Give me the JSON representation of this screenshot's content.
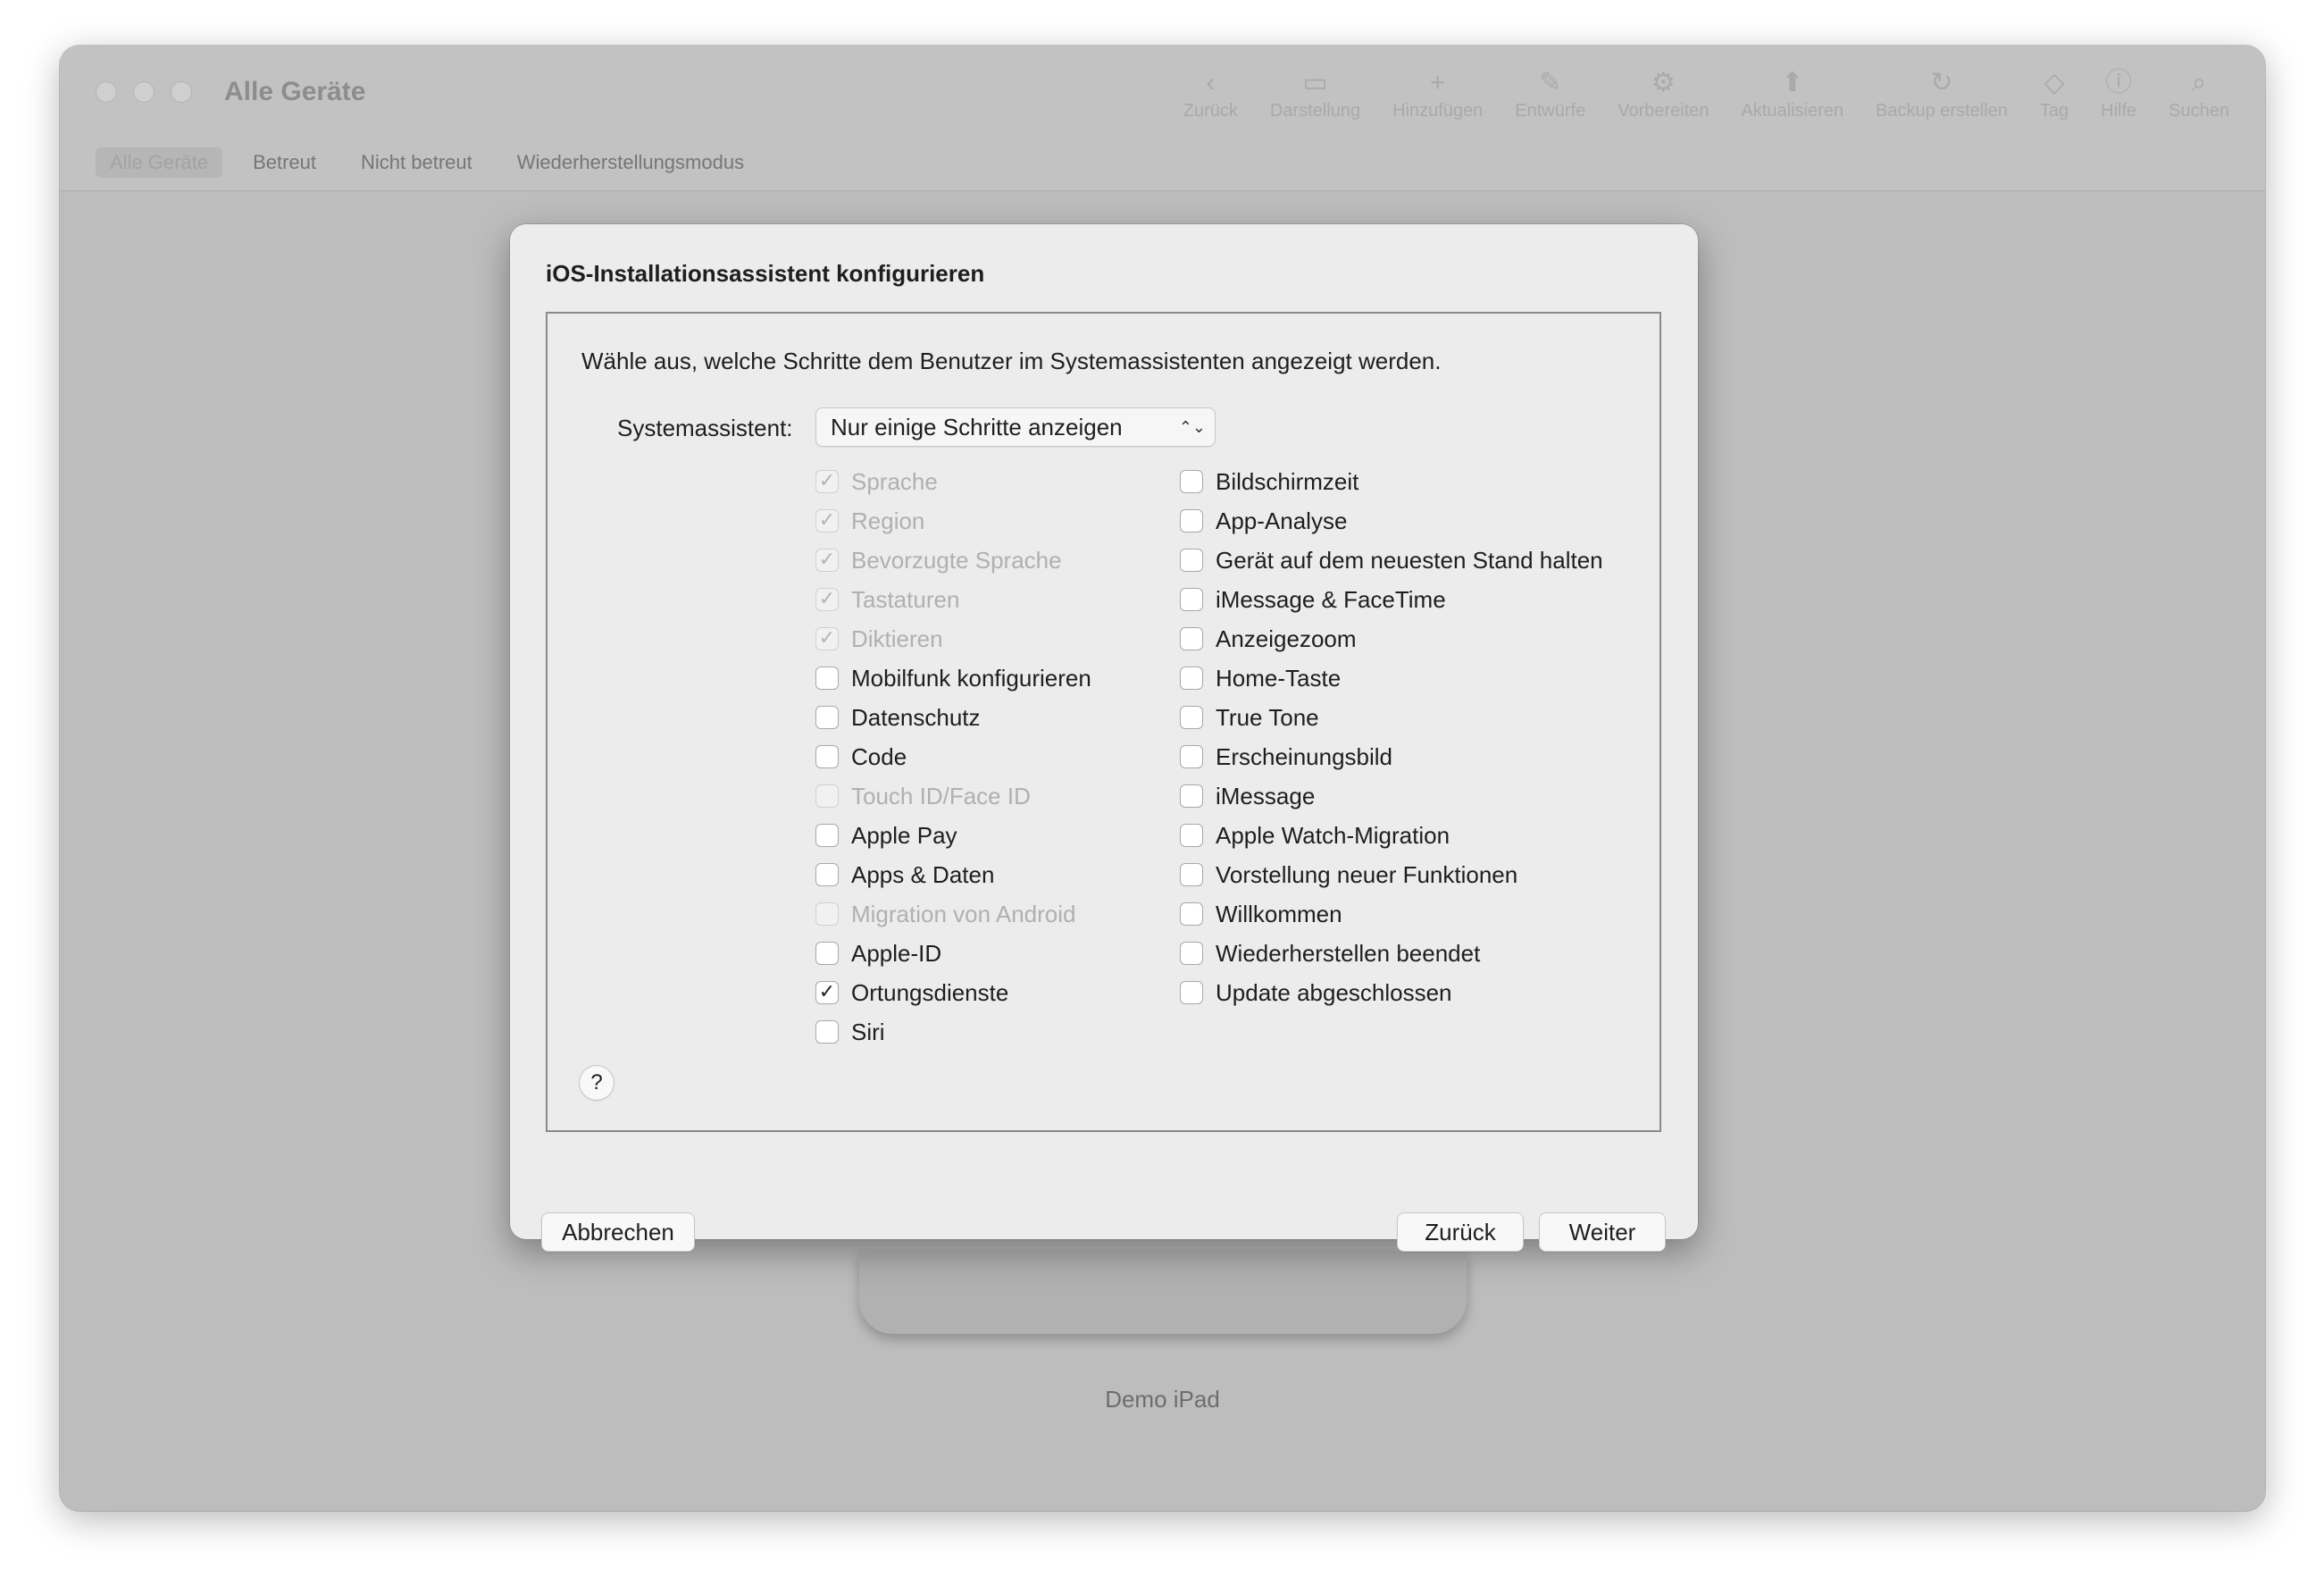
{
  "window": {
    "title": "Alle Geräte",
    "toolbar": [
      {
        "label": "Zurück",
        "icon": "chevron-left-icon",
        "glyph": "‹"
      },
      {
        "label": "Darstellung",
        "icon": "view-icon",
        "glyph": "▭"
      },
      {
        "label": "Hinzufügen",
        "icon": "plus-icon",
        "glyph": "+"
      },
      {
        "label": "Entwürfe",
        "icon": "draft-icon",
        "glyph": "✎"
      },
      {
        "label": "Vorbereiten",
        "icon": "prepare-icon",
        "glyph": "⚙"
      },
      {
        "label": "Aktualisieren",
        "icon": "update-icon",
        "glyph": "⬆"
      },
      {
        "label": "Backup erstellen",
        "icon": "backup-icon",
        "glyph": "↻"
      },
      {
        "label": "Tag",
        "icon": "tag-icon",
        "glyph": "◇"
      },
      {
        "label": "Hilfe",
        "icon": "help-icon",
        "glyph": "ⓘ"
      },
      {
        "label": "Suchen",
        "icon": "search-icon",
        "glyph": "⌕"
      }
    ],
    "tabs": [
      "Alle Geräte",
      "Betreut",
      "Nicht betreut",
      "Wiederherstellungsmodus"
    ],
    "selected_tab": "Alle Geräte",
    "device_label": "Demo iPad"
  },
  "dialog": {
    "title": "iOS-Installationsassistent konfigurieren",
    "intro": "Wähle aus, welche Schritte dem Benutzer im Systemassistenten angezeigt werden.",
    "assistant_label": "Systemassistent:",
    "assistant_value": "Nur einige Schritte anzeigen",
    "left_items": [
      {
        "label": "Sprache",
        "checked": true,
        "disabled": true
      },
      {
        "label": "Region",
        "checked": true,
        "disabled": true
      },
      {
        "label": "Bevorzugte Sprache",
        "checked": true,
        "disabled": true
      },
      {
        "label": "Tastaturen",
        "checked": true,
        "disabled": true
      },
      {
        "label": "Diktieren",
        "checked": true,
        "disabled": true
      },
      {
        "label": "Mobilfunk konfigurieren",
        "checked": false,
        "disabled": false
      },
      {
        "label": "Datenschutz",
        "checked": false,
        "disabled": false
      },
      {
        "label": "Code",
        "checked": false,
        "disabled": false
      },
      {
        "label": "Touch ID/Face ID",
        "checked": false,
        "disabled": true
      },
      {
        "label": "Apple Pay",
        "checked": false,
        "disabled": false
      },
      {
        "label": "Apps & Daten",
        "checked": false,
        "disabled": false
      },
      {
        "label": "Migration von Android",
        "checked": false,
        "disabled": true
      },
      {
        "label": "Apple-ID",
        "checked": false,
        "disabled": false
      },
      {
        "label": "Ortungsdienste",
        "checked": true,
        "disabled": false
      },
      {
        "label": "Siri",
        "checked": false,
        "disabled": false
      }
    ],
    "right_items": [
      {
        "label": "Bildschirmzeit",
        "checked": false,
        "disabled": false
      },
      {
        "label": "App-Analyse",
        "checked": false,
        "disabled": false
      },
      {
        "label": "Gerät auf dem neuesten Stand halten",
        "checked": false,
        "disabled": false
      },
      {
        "label": "iMessage & FaceTime",
        "checked": false,
        "disabled": false
      },
      {
        "label": "Anzeigezoom",
        "checked": false,
        "disabled": false
      },
      {
        "label": "Home-Taste",
        "checked": false,
        "disabled": false
      },
      {
        "label": "True Tone",
        "checked": false,
        "disabled": false
      },
      {
        "label": "Erscheinungsbild",
        "checked": false,
        "disabled": false
      },
      {
        "label": "iMessage",
        "checked": false,
        "disabled": false
      },
      {
        "label": "Apple Watch-Migration",
        "checked": false,
        "disabled": false
      },
      {
        "label": "Vorstellung neuer Funktionen",
        "checked": false,
        "disabled": false
      },
      {
        "label": "Willkommen",
        "checked": false,
        "disabled": false
      },
      {
        "label": "Wiederherstellen beendet",
        "checked": false,
        "disabled": false
      },
      {
        "label": "Update abgeschlossen",
        "checked": false,
        "disabled": false
      }
    ],
    "help_label": "?",
    "cancel_label": "Abbrechen",
    "back_label": "Zurück",
    "next_label": "Weiter"
  }
}
